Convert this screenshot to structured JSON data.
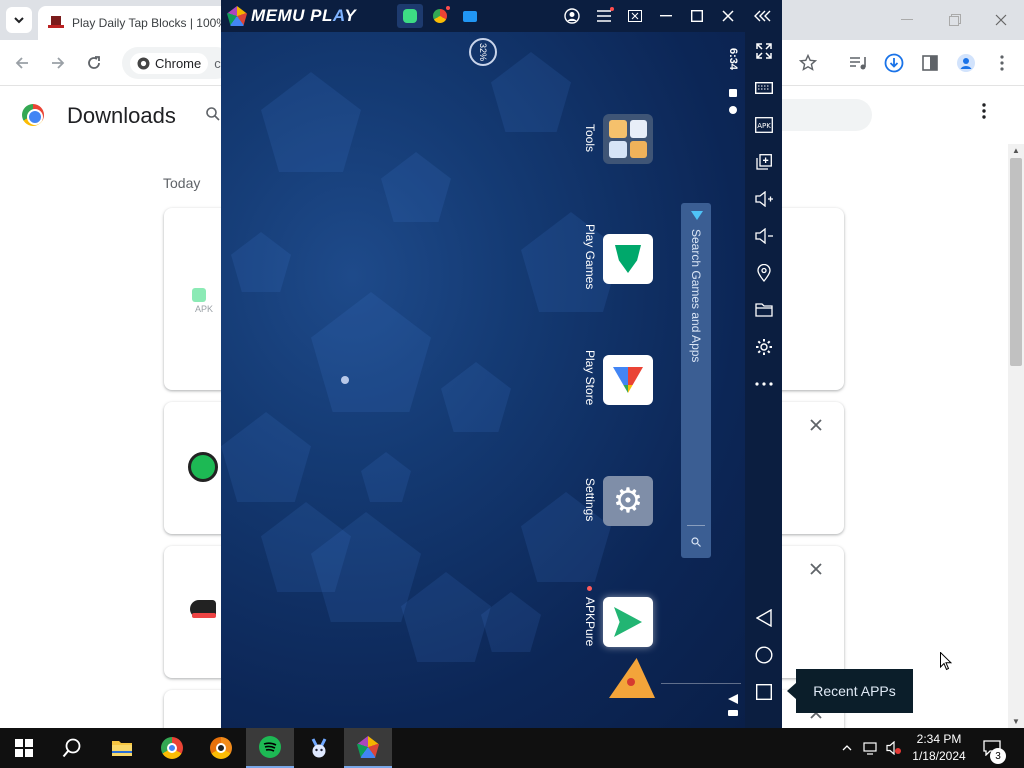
{
  "chrome": {
    "tab_title": "Play Daily Tap Blocks | 100%",
    "omnibox_chip": "Chrome",
    "omnibox_url": "ch",
    "page_title": "Downloads",
    "date_group": "Today",
    "apk_label": "APK"
  },
  "memu": {
    "brand": "MEMU PL",
    "brand_accent": "A",
    "brand_end": "Y",
    "status_time": "6:34",
    "battery": "32%",
    "apps": [
      {
        "label": "Tools"
      },
      {
        "label": "Play Games"
      },
      {
        "label": "Play Store"
      },
      {
        "label": "Settings"
      },
      {
        "label": "APKPure"
      }
    ],
    "search_placeholder": "Search Games and Apps",
    "side_apk_label": "APK",
    "tooltip": "Recent APPs"
  },
  "taskbar": {
    "time": "2:34 PM",
    "date": "1/18/2024",
    "notification_count": "3"
  },
  "colors": {
    "memu_bg": "#0e2a5b",
    "memu_bar": "#0b1e40",
    "chrome_tabstrip": "#dee1e6",
    "taskbar": "#101010"
  },
  "icons": [
    "search-icon",
    "star-icon",
    "download-icon",
    "profile-icon",
    "gear-icon",
    "location-icon",
    "folder-icon",
    "volume-up-icon",
    "volume-down-icon",
    "keyboard-icon",
    "fullscreen-icon"
  ]
}
